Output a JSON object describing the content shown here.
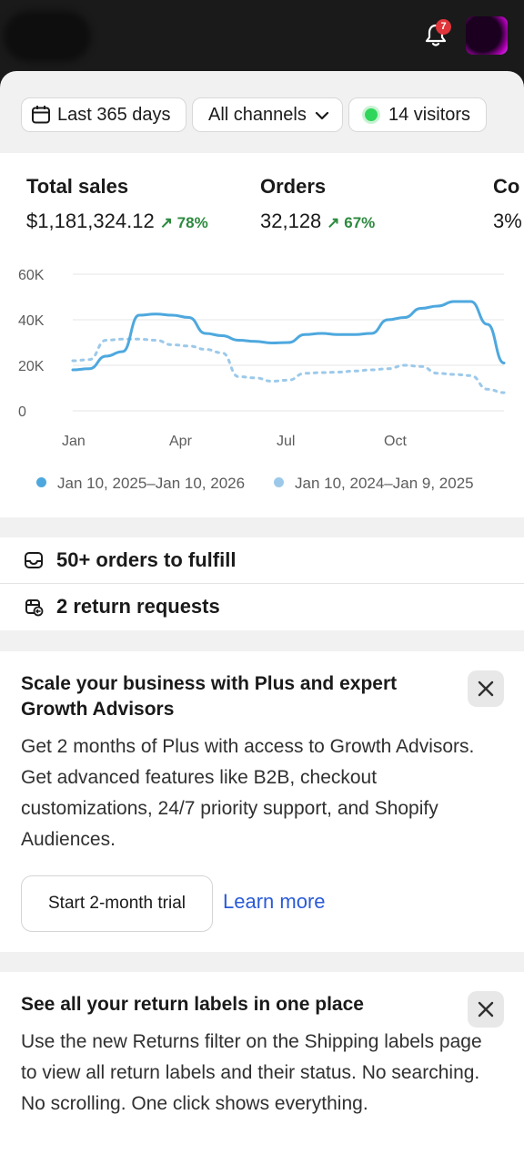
{
  "topbar": {
    "notification_count": "7"
  },
  "filters": {
    "date_range": "Last 365 days",
    "channels": "All channels",
    "visitors": "14 visitors"
  },
  "metrics": {
    "total_sales": {
      "label": "Total sales",
      "value": "$1,181,324.12",
      "delta": "78%"
    },
    "orders": {
      "label": "Orders",
      "value": "32,128",
      "delta": "67%"
    },
    "conversion": {
      "label": "Co",
      "value": "3%"
    }
  },
  "chart_data": {
    "type": "line",
    "title": "",
    "xlabel": "",
    "ylabel": "",
    "ylim": [
      0,
      60000
    ],
    "y_ticks": [
      "60K",
      "40K",
      "20K",
      "0"
    ],
    "x_ticks": [
      "Jan",
      "Apr",
      "Jul",
      "Oct"
    ],
    "grid": true,
    "legend_position": "bottom",
    "series": [
      {
        "name": "Jan 10, 2025–Jan 10, 2026",
        "style": "solid",
        "color": "#4ea8de",
        "values": [
          18000,
          18500,
          24000,
          26000,
          42000,
          42500,
          42000,
          41000,
          34000,
          33000,
          31000,
          30500,
          29800,
          30000,
          33500,
          34000,
          33500,
          33500,
          34000,
          40000,
          41000,
          45000,
          46000,
          48000,
          48000,
          38000,
          21000
        ]
      },
      {
        "name": "Jan 10, 2024–Jan 9, 2025",
        "style": "dotted",
        "color": "#9cc9ea",
        "values": [
          22000,
          22500,
          31000,
          31500,
          31500,
          31000,
          29000,
          28500,
          27000,
          25500,
          15000,
          14500,
          13000,
          13500,
          16500,
          16800,
          17000,
          17500,
          18000,
          18500,
          20000,
          19500,
          16500,
          16000,
          15500,
          9500,
          8000
        ]
      }
    ]
  },
  "tasks": {
    "orders_to_fulfill": "50+ orders to fulfill",
    "return_requests": "2 return requests"
  },
  "plus_card": {
    "title": "Scale your business with Plus and expert Growth Advisors",
    "body": "Get 2 months of Plus with access to Growth Advisors. Get advanced features like B2B, checkout customizations, 24/7 priority support, and Shopify Audiences.",
    "primary_button": "Start 2-month trial",
    "secondary_link": "Learn more"
  },
  "returns_card": {
    "title": "See all your return labels in one place",
    "body": "Use the new Returns filter on the Shipping labels page to view all return labels and their status. No searching. No scrolling. One click shows everything."
  },
  "colors": {
    "positive": "#2c8a3e",
    "link": "#2a5bd7",
    "badge": "#e0353a",
    "series_current": "#4ea8de",
    "series_previous": "#9cc9ea"
  },
  "icons": {
    "date": "calendar-icon",
    "channels": "chevron-down-icon",
    "visitors": "live-dot-icon",
    "fulfill": "inbox-icon",
    "returns": "return-box-icon",
    "notifications": "bell-icon",
    "dismiss": "close-icon"
  }
}
